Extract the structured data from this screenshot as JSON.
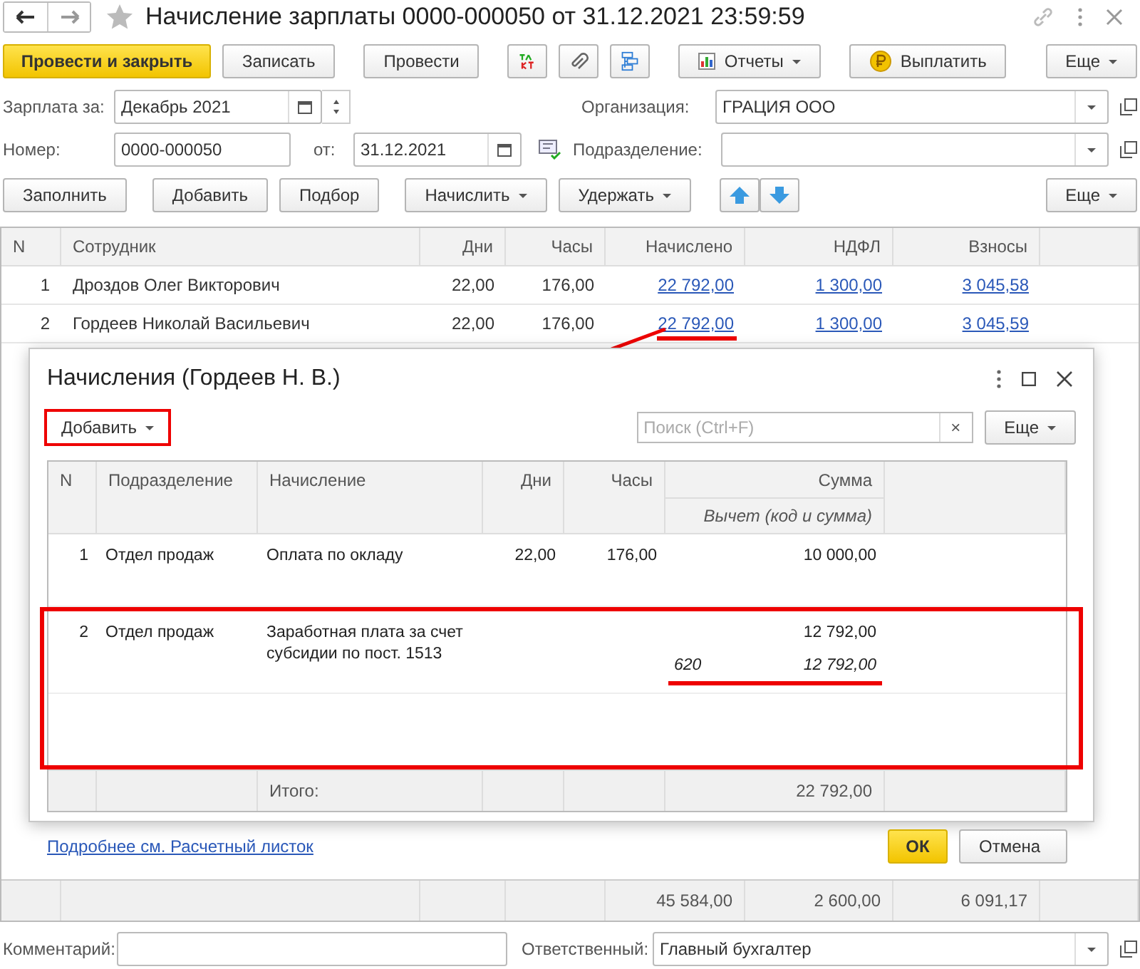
{
  "window": {
    "title": "Начисление зарплаты 0000-000050 от 31.12.2021 23:59:59"
  },
  "toolbar": {
    "post_close": "Провести и закрыть",
    "save": "Записать",
    "post": "Провести",
    "reports": "Отчеты",
    "pay": "Выплатить",
    "more": "Еще"
  },
  "fields": {
    "period_label": "Зарплата за:",
    "period": "Декабрь 2021",
    "org_label": "Организация:",
    "org": "ГРАЦИЯ ООО",
    "number_label": "Номер:",
    "number": "0000-000050",
    "date_label": "от:",
    "date": "31.12.2021",
    "dept_label": "Подразделение:"
  },
  "table_toolbar": {
    "fill": "Заполнить",
    "add": "Добавить",
    "pick": "Подбор",
    "accrue": "Начислить",
    "withhold": "Удержать",
    "more": "Еще"
  },
  "table": {
    "columns": [
      "N",
      "Сотрудник",
      "Дни",
      "Часы",
      "Начислено",
      "НДФЛ",
      "Взносы"
    ],
    "rows": [
      {
        "n": "1",
        "employee": "Дроздов Олег Викторович",
        "days": "22,00",
        "hours": "176,00",
        "accrued": "22 792,00",
        "ndfl": "1 300,00",
        "contributions": "3 045,58",
        "highlighted": false
      },
      {
        "n": "2",
        "employee": "Гордеев Николай Васильевич",
        "days": "22,00",
        "hours": "176,00",
        "accrued": "22 792,00",
        "ndfl": "1 300,00",
        "contributions": "3 045,59",
        "highlighted": true
      }
    ],
    "totals": {
      "accrued": "45 584,00",
      "ndfl": "2 600,00",
      "contributions": "6 091,17"
    }
  },
  "footer": {
    "comment_label": "Комментарий:",
    "responsible_label": "Ответственный:",
    "responsible": "Главный бухгалтер"
  },
  "dialog": {
    "title": "Начисления (Гордеев Н. В.)",
    "add": "Добавить",
    "add_highlighted": true,
    "search_placeholder": "Поиск (Ctrl+F)",
    "clear": "×",
    "more": "Еще",
    "columns": [
      "N",
      "Подразделение",
      "Начисление",
      "Дни",
      "Часы",
      "Сумма"
    ],
    "subheader": "Вычет (код и сумма)",
    "rows": [
      {
        "n": "1",
        "department": "Отдел продаж",
        "accrual": "Оплата по окладу",
        "days": "22,00",
        "hours": "176,00",
        "amount": "10 000,00",
        "highlighted": false
      },
      {
        "n": "2",
        "department": "Отдел продаж",
        "accrual": "Заработная плата за счет субсидии по пост. 1513",
        "amount": "12 792,00",
        "deduction_code": "620",
        "deduction_amount": "12 792,00",
        "highlighted": true
      }
    ],
    "total_label": "Итого:",
    "total": "22 792,00",
    "link": "Подробнее см. Расчетный листок",
    "ok": "ОК",
    "cancel": "Отмена"
  }
}
